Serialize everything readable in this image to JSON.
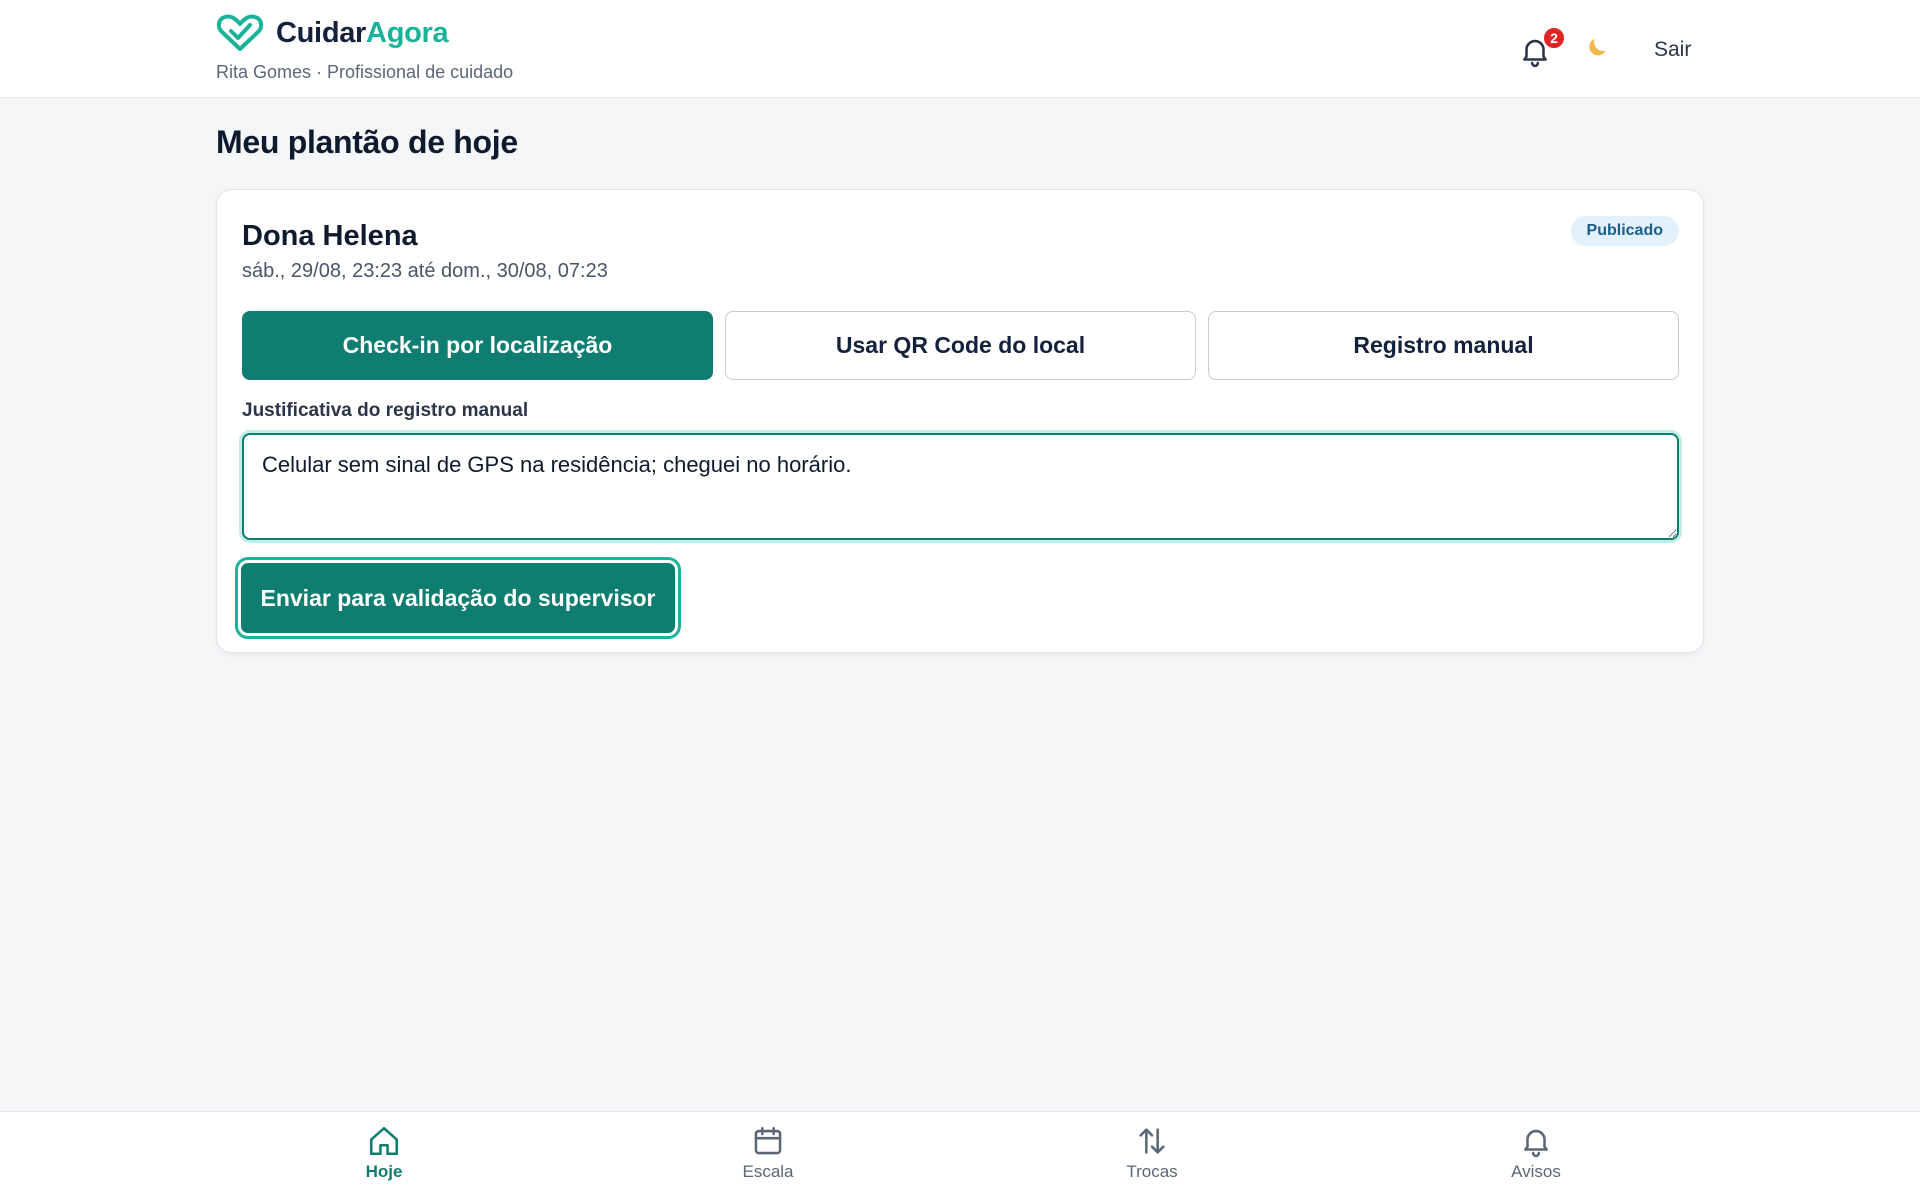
{
  "header": {
    "brand_part1": "Cuidar",
    "brand_part2": "Agora",
    "subtitle": "Rita Gomes · Profissional de cuidado",
    "notification_count": "2",
    "theme_icon": "moon-icon",
    "logout_label": "Sair"
  },
  "main": {
    "title": "Meu plantão de hoje",
    "shift": {
      "patient_name": "Dona Helena",
      "time_range": "sáb., 29/08, 23:23 até dom., 30/08, 07:23",
      "status": "Publicado",
      "methods": [
        {
          "label": "Check-in por localização",
          "active": true
        },
        {
          "label": "Usar QR Code do local",
          "active": false
        },
        {
          "label": "Registro manual",
          "active": false
        }
      ],
      "justification_label": "Justificativa do registro manual",
      "justification_value": "Celular sem sinal de GPS na residência; cheguei no horário.",
      "submit_label": "Enviar para validação do supervisor"
    }
  },
  "bottom_nav": {
    "items": [
      {
        "label": "Hoje",
        "icon": "home-icon",
        "active": true
      },
      {
        "label": "Escala",
        "icon": "calendar-icon",
        "active": false
      },
      {
        "label": "Trocas",
        "icon": "swap-arrows-icon",
        "active": false
      },
      {
        "label": "Avisos",
        "icon": "bell-icon",
        "active": false
      }
    ]
  },
  "colors": {
    "primary": "#0f7d6f",
    "accent": "#19b39a",
    "badge_red": "#e02424",
    "status_bg": "#e2f1fb"
  }
}
